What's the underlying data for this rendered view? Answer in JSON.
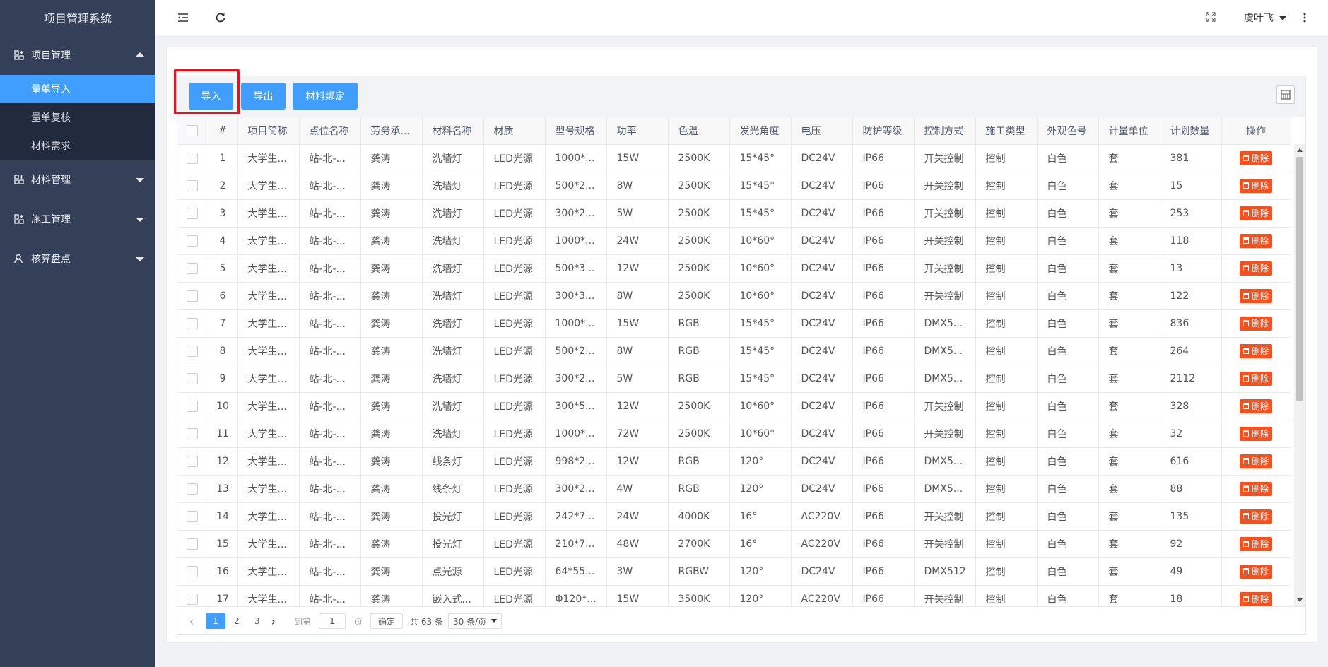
{
  "app": {
    "title": "项目管理系统"
  },
  "sidebar": {
    "groups": [
      {
        "label": "项目管理",
        "expanded": true,
        "items": [
          {
            "label": "量单导入",
            "active": true
          },
          {
            "label": "量单复核",
            "active": false
          },
          {
            "label": "材料需求",
            "active": false
          }
        ]
      },
      {
        "label": "材料管理",
        "expanded": false
      },
      {
        "label": "施工管理",
        "expanded": false
      },
      {
        "label": "核算盘点",
        "expanded": false
      }
    ]
  },
  "header": {
    "user": "虞叶飞",
    "icons": [
      "menu-fold-icon",
      "refresh-icon",
      "fullscreen-icon",
      "more-vertical-icon"
    ]
  },
  "toolbar": {
    "import_label": "导入",
    "export_label": "导出",
    "bind_label": "材料绑定"
  },
  "colors": {
    "primary": "#409eff",
    "sidebar": "#344058",
    "submenu": "#222b3e",
    "danger": "#f4511e",
    "highlight": "#e5131d"
  },
  "table": {
    "columns": [
      "#",
      "项目简称",
      "点位名称",
      "劳务承...",
      "材料名称",
      "材质",
      "型号规格",
      "功率",
      "色温",
      "发光角度",
      "电压",
      "防护等级",
      "控制方式",
      "施工类型",
      "外观色号",
      "计量单位",
      "计划数量",
      "操作"
    ],
    "delete_label": "删除",
    "rows": [
      [
        "1",
        "大学生...",
        "站-北-...",
        "龚涛",
        "洗墙灯",
        "LED光源",
        "1000*...",
        "15W",
        "2500K",
        "15*45°",
        "DC24V",
        "IP66",
        "开关控制",
        "控制",
        "白色",
        "套",
        "381"
      ],
      [
        "2",
        "大学生...",
        "站-北-...",
        "龚涛",
        "洗墙灯",
        "LED光源",
        "500*2...",
        "8W",
        "2500K",
        "15*45°",
        "DC24V",
        "IP66",
        "开关控制",
        "控制",
        "白色",
        "套",
        "15"
      ],
      [
        "3",
        "大学生...",
        "站-北-...",
        "龚涛",
        "洗墙灯",
        "LED光源",
        "300*2...",
        "5W",
        "2500K",
        "15*45°",
        "DC24V",
        "IP66",
        "开关控制",
        "控制",
        "白色",
        "套",
        "253"
      ],
      [
        "4",
        "大学生...",
        "站-北-...",
        "龚涛",
        "洗墙灯",
        "LED光源",
        "1000*...",
        "24W",
        "2500K",
        "10*60°",
        "DC24V",
        "IP66",
        "开关控制",
        "控制",
        "白色",
        "套",
        "118"
      ],
      [
        "5",
        "大学生...",
        "站-北-...",
        "龚涛",
        "洗墙灯",
        "LED光源",
        "500*3...",
        "12W",
        "2500K",
        "10*60°",
        "DC24V",
        "IP66",
        "开关控制",
        "控制",
        "白色",
        "套",
        "13"
      ],
      [
        "6",
        "大学生...",
        "站-北-...",
        "龚涛",
        "洗墙灯",
        "LED光源",
        "300*3...",
        "8W",
        "2500K",
        "10*60°",
        "DC24V",
        "IP66",
        "开关控制",
        "控制",
        "白色",
        "套",
        "122"
      ],
      [
        "7",
        "大学生...",
        "站-北-...",
        "龚涛",
        "洗墙灯",
        "LED光源",
        "1000*...",
        "15W",
        "RGB",
        "15*45°",
        "DC24V",
        "IP66",
        "DMX5...",
        "控制",
        "白色",
        "套",
        "836"
      ],
      [
        "8",
        "大学生...",
        "站-北-...",
        "龚涛",
        "洗墙灯",
        "LED光源",
        "500*2...",
        "8W",
        "RGB",
        "15*45°",
        "DC24V",
        "IP66",
        "DMX5...",
        "控制",
        "白色",
        "套",
        "264"
      ],
      [
        "9",
        "大学生...",
        "站-北-...",
        "龚涛",
        "洗墙灯",
        "LED光源",
        "300*2...",
        "5W",
        "RGB",
        "15*45°",
        "DC24V",
        "IP66",
        "DMX5...",
        "控制",
        "白色",
        "套",
        "2112"
      ],
      [
        "10",
        "大学生...",
        "站-北-...",
        "龚涛",
        "洗墙灯",
        "LED光源",
        "300*5...",
        "12W",
        "2500K",
        "10*60°",
        "DC24V",
        "IP66",
        "开关控制",
        "控制",
        "白色",
        "套",
        "328"
      ],
      [
        "11",
        "大学生...",
        "站-北-...",
        "龚涛",
        "洗墙灯",
        "LED光源",
        "1000*...",
        "72W",
        "2500K",
        "10*60°",
        "DC24V",
        "IP66",
        "开关控制",
        "控制",
        "白色",
        "套",
        "32"
      ],
      [
        "12",
        "大学生...",
        "站-北-...",
        "龚涛",
        "线条灯",
        "LED光源",
        "998*2...",
        "12W",
        "RGB",
        "120°",
        "DC24V",
        "IP66",
        "DMX5...",
        "控制",
        "白色",
        "套",
        "616"
      ],
      [
        "13",
        "大学生...",
        "站-北-...",
        "龚涛",
        "线条灯",
        "LED光源",
        "300*2...",
        "4W",
        "RGB",
        "120°",
        "DC24V",
        "IP66",
        "DMX5...",
        "控制",
        "白色",
        "套",
        "88"
      ],
      [
        "14",
        "大学生...",
        "站-北-...",
        "龚涛",
        "投光灯",
        "LED光源",
        "242*7...",
        "24W",
        "4000K",
        "16°",
        "AC220V",
        "IP66",
        "开关控制",
        "控制",
        "白色",
        "套",
        "135"
      ],
      [
        "15",
        "大学生...",
        "站-北-...",
        "龚涛",
        "投光灯",
        "LED光源",
        "210*7...",
        "48W",
        "2700K",
        "16°",
        "AC220V",
        "IP66",
        "开关控制",
        "控制",
        "白色",
        "套",
        "92"
      ],
      [
        "16",
        "大学生...",
        "站-北-...",
        "龚涛",
        "点光源",
        "LED光源",
        "64*55...",
        "3W",
        "RGBW",
        "120°",
        "DC24V",
        "IP66",
        "DMX512",
        "控制",
        "白色",
        "套",
        "49"
      ],
      [
        "17",
        "大学生...",
        "站-北-...",
        "龚涛",
        "嵌入式...",
        "LED光源",
        "Φ120*...",
        "15W",
        "3500K",
        "120°",
        "AC220V",
        "IP66",
        "开关控制",
        "控制",
        "白色",
        "套",
        "18"
      ]
    ]
  },
  "pagination": {
    "pages": [
      "1",
      "2",
      "3"
    ],
    "current": "1",
    "goto_label": "到第",
    "page_value": "1",
    "page_unit": "页",
    "confirm_label": "确定",
    "total_label": "共 63 条",
    "page_size": "30 条/页"
  }
}
